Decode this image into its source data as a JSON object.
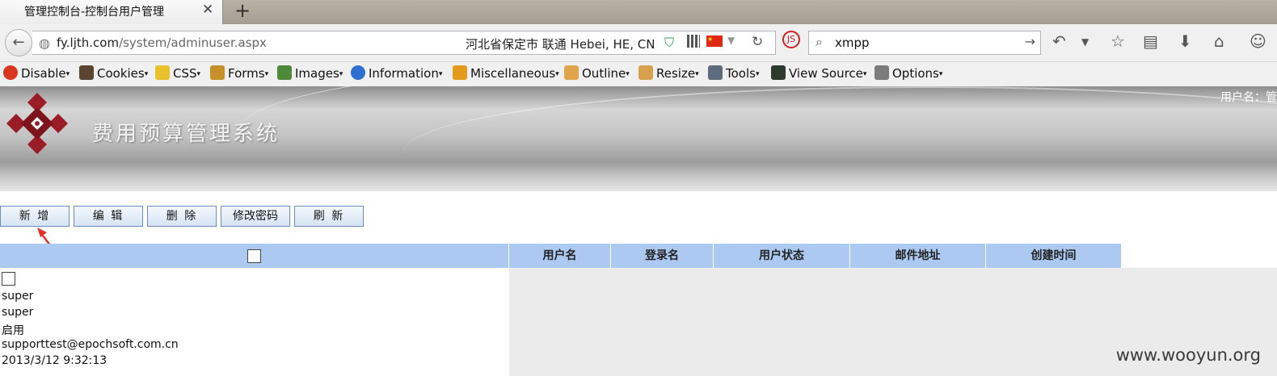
{
  "browser": {
    "tab_title": "管理控制台-控制台用户管理",
    "tab_close": "✕",
    "new_tab": "+",
    "url_host": "fy.ljth.com",
    "url_path": "/system/adminuser.aspx",
    "geo_text": "河北省保定市 联通   Hebei, HE, CN",
    "search_value": "xmpp"
  },
  "devbar": {
    "items": [
      {
        "label": "Disable",
        "icon": "disable-icon",
        "color": "#d9381e"
      },
      {
        "label": "Cookies",
        "icon": "cookies-icon",
        "color": "#5a4630"
      },
      {
        "label": "CSS",
        "icon": "css-icon",
        "color": "#e8c12c"
      },
      {
        "label": "Forms",
        "icon": "forms-icon",
        "color": "#c8902a"
      },
      {
        "label": "Images",
        "icon": "images-icon",
        "color": "#4f8a3a"
      },
      {
        "label": "Information",
        "icon": "information-icon",
        "color": "#2f6fd0"
      },
      {
        "label": "Miscellaneous",
        "icon": "miscellaneous-icon",
        "color": "#e59a1c"
      },
      {
        "label": "Outline",
        "icon": "outline-icon",
        "color": "#e0a54a"
      },
      {
        "label": "Resize",
        "icon": "resize-icon",
        "color": "#d9a04e"
      },
      {
        "label": "Tools",
        "icon": "tools-icon",
        "color": "#5c6c7c"
      },
      {
        "label": "View Source",
        "icon": "view-source-icon",
        "color": "#2d3b2d"
      },
      {
        "label": "Options",
        "icon": "options-icon",
        "color": "#7c7c7c"
      }
    ]
  },
  "app": {
    "system_title": "费用预算管理系统",
    "user_label": "用户名：管"
  },
  "toolbar": {
    "buttons": [
      {
        "label": "新 增"
      },
      {
        "label": "编 辑"
      },
      {
        "label": "删 除"
      },
      {
        "label": "修改密码"
      },
      {
        "label": "刷 新"
      }
    ]
  },
  "grid": {
    "columns": [
      "用户名",
      "登录名",
      "用户状态",
      "邮件地址",
      "创建时间"
    ],
    "rows": [
      {
        "username": "super",
        "login": "super",
        "status": "启用",
        "email": "supporttest@epochsoft.com.cn",
        "created": "2013/3/12 9:32:13"
      }
    ]
  },
  "watermark": "www.wooyun.org",
  "colors": {
    "header_blue": "#abc9f1",
    "button_border": "#6b8fbd",
    "annotation_arrow": "#e8302a"
  }
}
